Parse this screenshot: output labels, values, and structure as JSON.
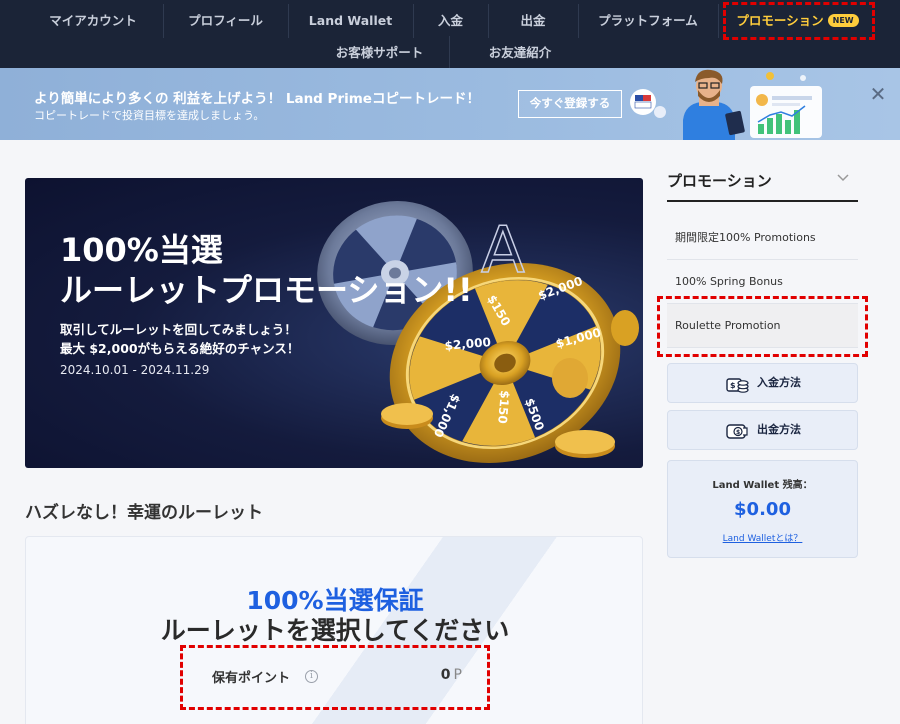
{
  "nav": {
    "row1": [
      {
        "label": "マイアカウント"
      },
      {
        "label": "プロフィール"
      },
      {
        "label": "Land Wallet"
      },
      {
        "label": "入金"
      },
      {
        "label": "出金"
      },
      {
        "label": "プラットフォーム"
      },
      {
        "label": "プロモーション",
        "badge": "NEW",
        "active": true
      }
    ],
    "row2": [
      {
        "label": "お客様サポート"
      },
      {
        "label": "お友達紹介"
      }
    ]
  },
  "banner": {
    "title": "より簡単により多くの 利益を上げよう！ Land Primeコピートレード！",
    "subtitle": "コピートレードで投資目標を達成しましょう。",
    "button": "今すぐ登録する",
    "close_icon": "close-icon"
  },
  "hero": {
    "title_line1": "100%当選",
    "title_line2": "ルーレットプロモーション!!",
    "desc_line1": "取引してルーレットを回してみましょう！",
    "desc_line2": "最大 $2,000がもらえる絶好のチャンス！",
    "date": "2024.10.01 - 2024.11.29",
    "wheel_labels": [
      "$2,000",
      "$1,000",
      "$500",
      "$150",
      "$1,000",
      "$2,000",
      "$150"
    ],
    "letter": "A"
  },
  "roulette": {
    "heading": "ハズレなし！幸運のルーレット",
    "guarantee": "100%当選保証",
    "select_text": "ルーレットを選択してください",
    "points_label": "保有ポイント",
    "points_value": "0",
    "points_unit": "P"
  },
  "sidebar": {
    "title": "プロモーション",
    "items": [
      {
        "label": "期間限定100% Promotions"
      },
      {
        "label": "100% Spring Bonus"
      },
      {
        "label": "Roulette Promotion",
        "selected": true
      }
    ],
    "deposit_label": "入金方法",
    "withdraw_label": "出金方法",
    "wallet_label": "Land Wallet 残高：",
    "wallet_amount": "$0.00",
    "wallet_link": "Land Walletとは？"
  },
  "colors": {
    "nav_bg": "#1b2437",
    "active": "#ffcd3c",
    "accent_blue": "#1e60e0",
    "highlight": "#e10000"
  }
}
